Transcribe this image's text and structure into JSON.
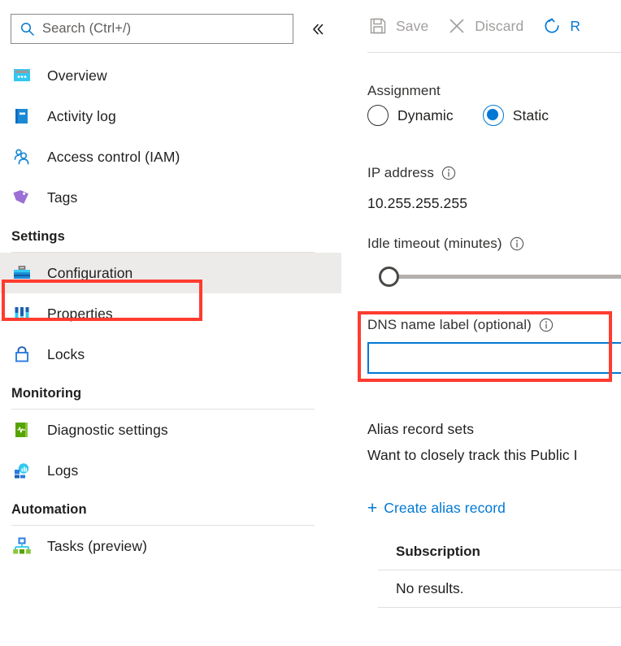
{
  "search": {
    "placeholder": "Search (Ctrl+/)",
    "icon": "search-icon",
    "collapse_icon": "double-chevron-left-icon"
  },
  "sidebar": {
    "items": [
      {
        "label": "Overview",
        "icon": "overview-icon",
        "selected": false
      },
      {
        "label": "Activity log",
        "icon": "activity-log-icon",
        "selected": false
      },
      {
        "label": "Access control (IAM)",
        "icon": "access-control-icon",
        "selected": false
      },
      {
        "label": "Tags",
        "icon": "tags-icon",
        "selected": false
      }
    ],
    "groups": [
      {
        "title": "Settings",
        "items": [
          {
            "label": "Configuration",
            "icon": "configuration-icon",
            "selected": true
          },
          {
            "label": "Properties",
            "icon": "properties-icon",
            "selected": false
          },
          {
            "label": "Locks",
            "icon": "locks-icon",
            "selected": false
          }
        ]
      },
      {
        "title": "Monitoring",
        "items": [
          {
            "label": "Diagnostic settings",
            "icon": "diagnostic-settings-icon",
            "selected": false
          },
          {
            "label": "Logs",
            "icon": "logs-icon",
            "selected": false
          }
        ]
      },
      {
        "title": "Automation",
        "items": [
          {
            "label": "Tasks (preview)",
            "icon": "tasks-icon",
            "selected": false
          }
        ]
      }
    ]
  },
  "toolbar": {
    "save_label": "Save",
    "save_icon": "save-disk-icon",
    "save_enabled": false,
    "discard_label": "Discard",
    "discard_icon": "close-x-icon",
    "discard_enabled": false,
    "refresh_label": "R",
    "refresh_icon": "refresh-icon",
    "refresh_enabled": true
  },
  "main": {
    "assignment": {
      "label": "Assignment",
      "options": [
        "Dynamic",
        "Static"
      ],
      "selected": "Static"
    },
    "ip_address": {
      "label": "IP address",
      "value": "10.255.255.255",
      "info_icon": "info-icon"
    },
    "idle_timeout": {
      "label": "Idle timeout (minutes)",
      "info_icon": "info-icon",
      "slider_position_percent": 0
    },
    "dns_name_label": {
      "label": "DNS name label (optional)",
      "info_icon": "info-icon",
      "value": "",
      "placeholder": "",
      "focused": true
    },
    "alias_records": {
      "heading": "Alias record sets",
      "description": "Want to closely track this Public I",
      "create_link": "Create alias record",
      "create_link_plus": "+"
    },
    "subscription_table": {
      "header": "Subscription",
      "rows": [
        "No results."
      ]
    }
  },
  "annotations": {
    "colors": {
      "highlight": "#ff3b30",
      "accent": "#0078d4",
      "selected_row_bg": "#edebe9"
    },
    "boxes": [
      {
        "name": "configuration-highlight"
      },
      {
        "name": "dns-name-label-highlight"
      }
    ]
  }
}
